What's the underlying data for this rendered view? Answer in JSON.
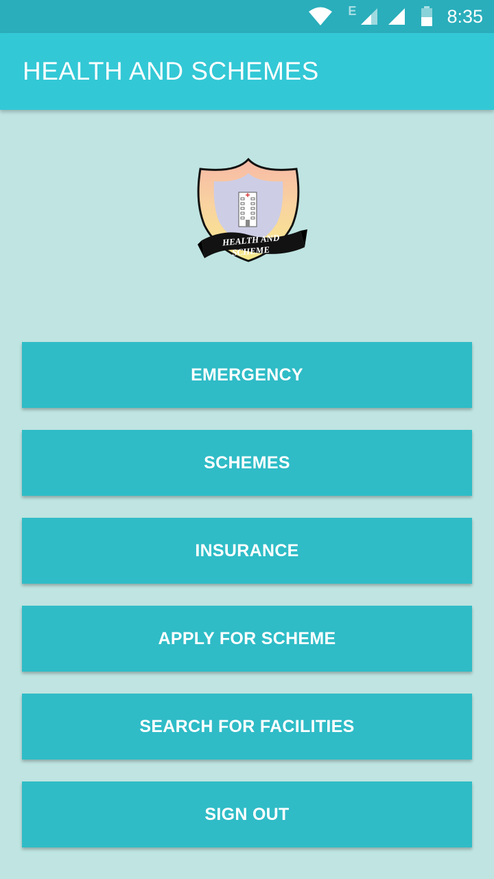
{
  "status_bar": {
    "network_label": "E",
    "time": "8:35"
  },
  "app_bar": {
    "title": "HEALTH AND SCHEMES"
  },
  "logo": {
    "text_line1": "HEALTH AND",
    "text_line2": "SCHEME"
  },
  "menu": {
    "items": [
      {
        "label": "EMERGENCY"
      },
      {
        "label": "SCHEMES"
      },
      {
        "label": "INSURANCE"
      },
      {
        "label": "APPLY FOR SCHEME"
      },
      {
        "label": "SEARCH FOR FACILITIES"
      },
      {
        "label": "SIGN OUT"
      }
    ]
  },
  "colors": {
    "status_bar": "#2aaebb",
    "app_bar": "#33c8d6",
    "background": "#bfe4e1",
    "button": "#2fbcc7",
    "button_text": "#ffffff"
  }
}
